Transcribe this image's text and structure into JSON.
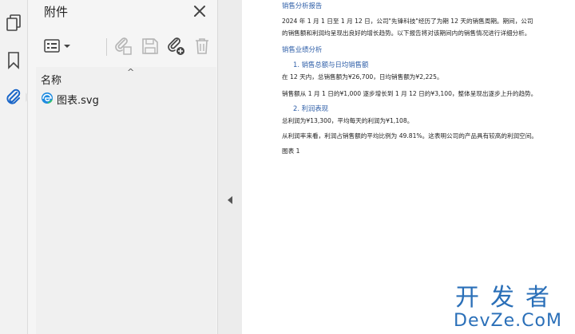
{
  "left_rail": {
    "items": [
      {
        "name": "pages-icon"
      },
      {
        "name": "bookmark-icon"
      },
      {
        "name": "attachment-icon"
      }
    ]
  },
  "panel": {
    "title": "附件",
    "column_name": "名称",
    "sort_glyph": "^",
    "files": [
      {
        "name": "图表.svg",
        "icon": "edge-browser-icon"
      }
    ]
  },
  "document": {
    "title": "销售分析报告",
    "intro": "2024 年 1 月 1 日至 1 月 12 日，公司\"先锋科技\"经历了为期 12 天的销售周期。期间，公司的销售额和利润均呈现出良好的增长趋势。以下报告将对该期间内的销售情况进行详细分析。",
    "section1_title": "销售业绩分析",
    "item1_title": "1.  销售总额与日均销售额",
    "item1_p1": "在 12 天内，总销售额为¥26,700，日均销售额为¥2,225。",
    "item1_p2": "销售额从 1 月 1 日的¥1,000 逐步增长到 1 月 12 日的¥3,100，整体呈现出逐步上升的趋势。",
    "item2_title": "2.  利润表现",
    "item2_p1": "总利润为¥13,300，平均每天的利润为¥1,108。",
    "item2_p2": "从利润率来看，利润占销售额的平均比例为 49.81%。这表明公司的产品具有较高的利润空间。",
    "figure_label": "图表 1"
  },
  "watermark": {
    "cn": "开发者",
    "en": "DevZe.CoM"
  },
  "colors": {
    "accent_blue": "#2f5fa8",
    "attachment_icon": "#1a66c8"
  }
}
